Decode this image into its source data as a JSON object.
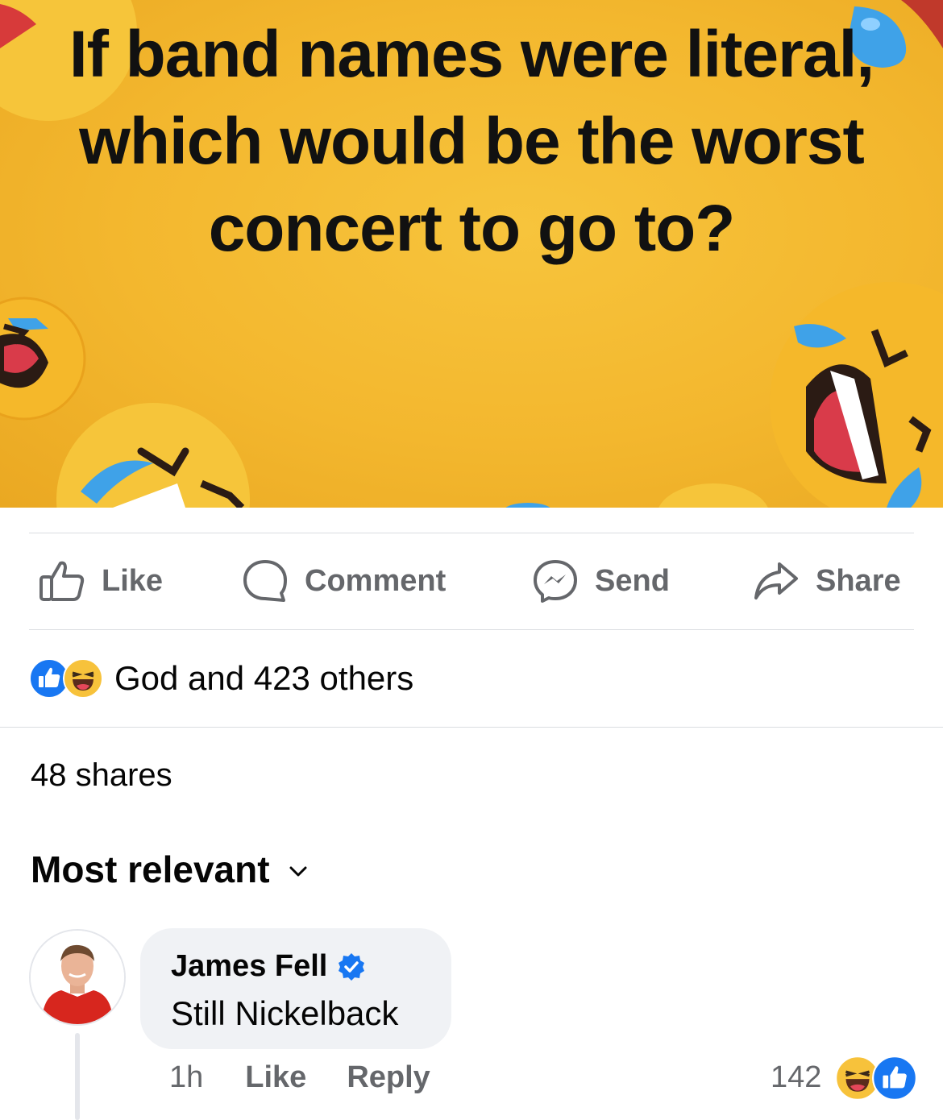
{
  "post": {
    "image_text": "If band names were literal, which would be the worst concert to go to?",
    "background_color": "#f3b72e"
  },
  "actions": [
    {
      "label": "Like",
      "icon": "thumbs-up-outline-icon"
    },
    {
      "label": "Comment",
      "icon": "speech-bubble-icon"
    },
    {
      "label": "Send",
      "icon": "messenger-icon"
    },
    {
      "label": "Share",
      "icon": "share-arrow-icon"
    }
  ],
  "reactions": {
    "icons": [
      "like-reaction-icon",
      "haha-reaction-icon"
    ],
    "summary": "God and 423 others"
  },
  "shares": "48 shares",
  "sort": {
    "label": "Most relevant",
    "icon": "chevron-down-icon"
  },
  "comment": {
    "author": "James Fell",
    "verified": true,
    "text": "Still Nickelback",
    "time": "1h",
    "like_label": "Like",
    "reply_label": "Reply",
    "reaction_count": "142",
    "reaction_icons": [
      "haha-reaction-icon",
      "like-reaction-icon"
    ]
  },
  "colors": {
    "accent_blue": "#1877f2",
    "secondary_text": "#65676b",
    "bubble": "#f0f2f5"
  }
}
